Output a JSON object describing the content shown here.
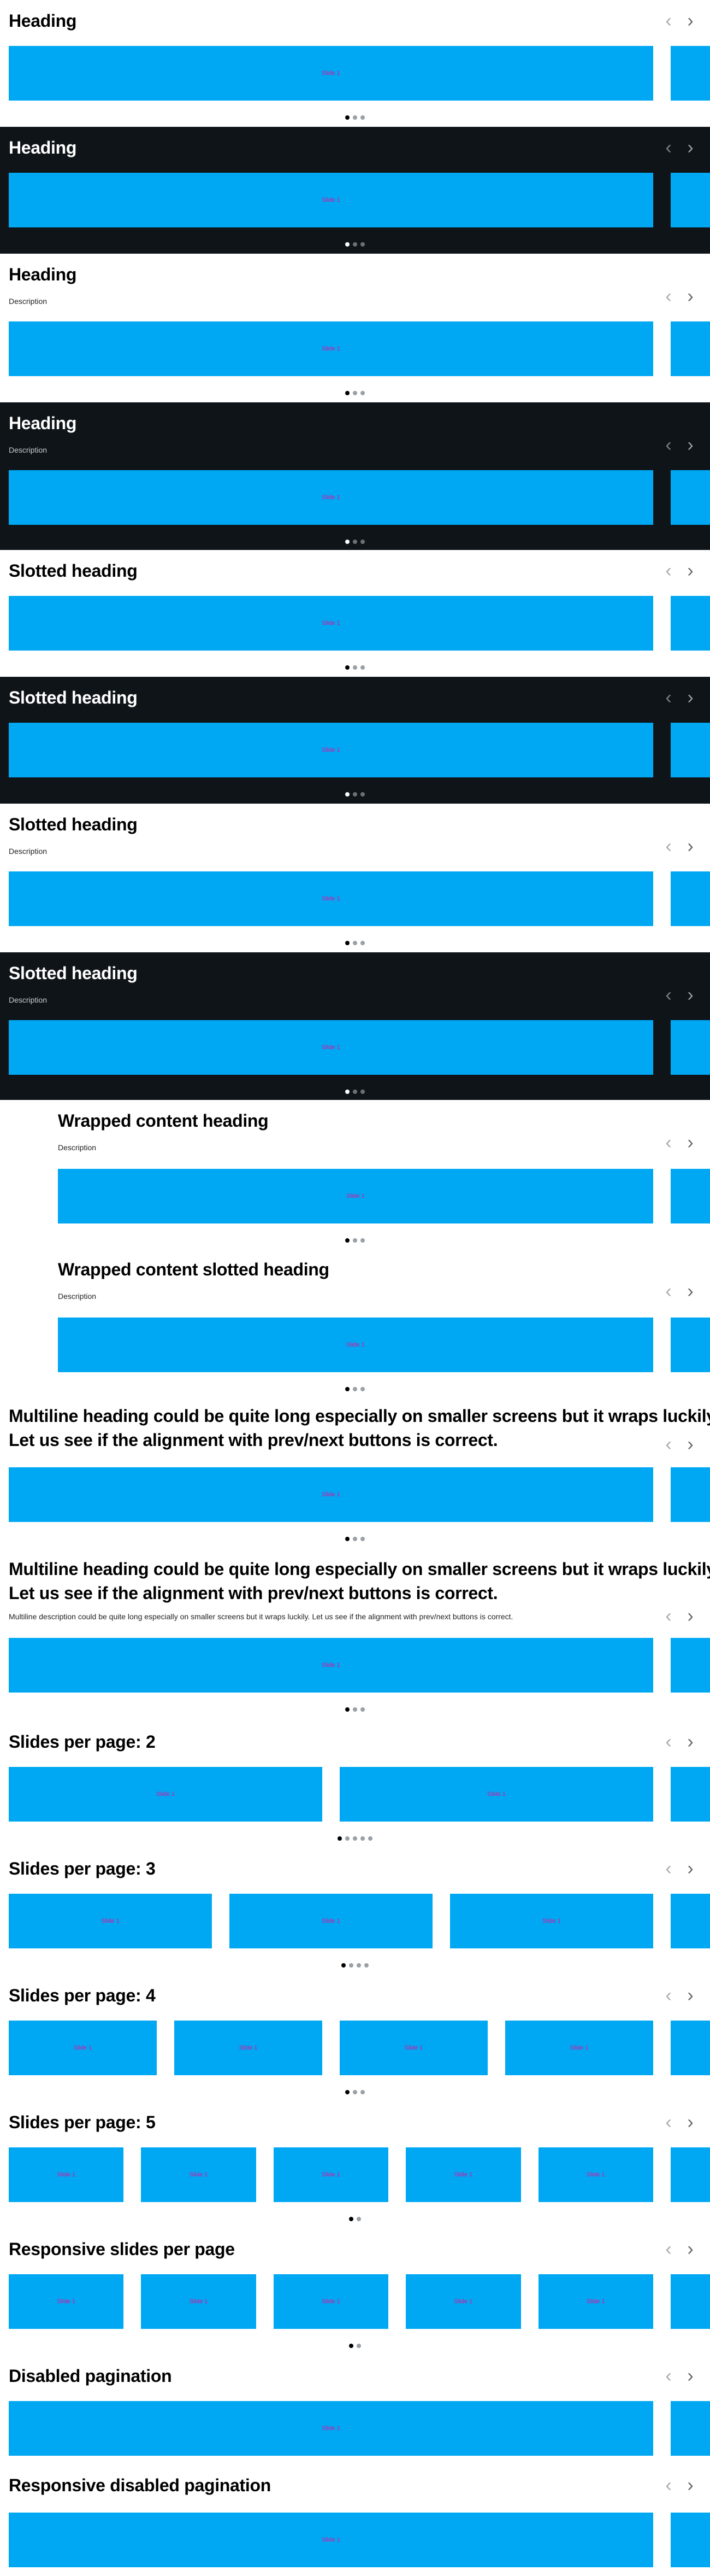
{
  "slide_label": "Slide 1",
  "nav": {
    "prev_symbol": "‹",
    "next_symbol": "›"
  },
  "colors": {
    "slide": "#00a8f3",
    "slide_text": "#e0109c",
    "dark_bg": "#0e1418"
  },
  "carousels": [
    {
      "heading": "Heading",
      "description": "",
      "theme": "light",
      "slides_per_page": 1,
      "pages": 3,
      "active_page": 1
    },
    {
      "heading": "Heading",
      "description": "",
      "theme": "dark",
      "slides_per_page": 1,
      "pages": 3,
      "active_page": 1
    },
    {
      "heading": "Heading",
      "description": "Description",
      "theme": "light",
      "slides_per_page": 1,
      "pages": 3,
      "active_page": 1
    },
    {
      "heading": "Heading",
      "description": "Description",
      "theme": "dark",
      "slides_per_page": 1,
      "pages": 3,
      "active_page": 1
    },
    {
      "heading": "Slotted heading",
      "description": "",
      "theme": "light",
      "slides_per_page": 1,
      "pages": 3,
      "active_page": 1
    },
    {
      "heading": "Slotted heading",
      "description": "",
      "theme": "dark",
      "slides_per_page": 1,
      "pages": 3,
      "active_page": 1
    },
    {
      "heading": "Slotted heading",
      "description": "Description",
      "theme": "light",
      "slides_per_page": 1,
      "pages": 3,
      "active_page": 1
    },
    {
      "heading": "Slotted heading",
      "description": "Description",
      "theme": "dark",
      "slides_per_page": 1,
      "pages": 3,
      "active_page": 1
    },
    {
      "heading": "Wrapped content heading",
      "description": "Description",
      "theme": "light",
      "slides_per_page": 1,
      "pages": 3,
      "active_page": 1
    },
    {
      "heading": "Wrapped content slotted heading",
      "description": "Description",
      "theme": "light",
      "slides_per_page": 1,
      "pages": 3,
      "active_page": 1
    },
    {
      "heading": [
        "Multiline heading could be quite long especially on smaller screens but it wraps luckily.",
        "Let us see if the alignment with prev/next buttons is correct."
      ],
      "description": "",
      "theme": "light",
      "slides_per_page": 1,
      "pages": 3,
      "active_page": 1
    },
    {
      "heading": [
        "Multiline heading could be quite long especially on smaller screens but it wraps luckily.",
        "Let us see if the alignment with prev/next buttons is correct."
      ],
      "description": "Multiline description could be quite long especially on smaller screens but it wraps luckily. Let us see if the alignment with prev/next buttons is correct.",
      "theme": "light",
      "slides_per_page": 1,
      "pages": 3,
      "active_page": 1
    },
    {
      "heading": "Slides per page: 2",
      "description": "",
      "theme": "light",
      "slides_per_page": 2,
      "pages": 5,
      "active_page": 1
    },
    {
      "heading": "Slides per page: 3",
      "description": "",
      "theme": "light",
      "slides_per_page": 3,
      "pages": 4,
      "active_page": 1
    },
    {
      "heading": "Slides per page: 4",
      "description": "",
      "theme": "light",
      "slides_per_page": 4,
      "pages": 3,
      "active_page": 1
    },
    {
      "heading": "Slides per page: 5",
      "description": "",
      "theme": "light",
      "slides_per_page": 5,
      "pages": 2,
      "active_page": 1
    },
    {
      "heading": "Responsive slides per page",
      "description": "",
      "theme": "light",
      "slides_per_page": 5,
      "pages": 2,
      "active_page": 1
    },
    {
      "heading": "Disabled pagination",
      "description": "",
      "theme": "light",
      "slides_per_page": 1,
      "pages": 0,
      "active_page": 0
    },
    {
      "heading": "Responsive disabled pagination",
      "description": "",
      "theme": "light",
      "slides_per_page": 1,
      "pages": 0,
      "active_page": 0
    }
  ]
}
